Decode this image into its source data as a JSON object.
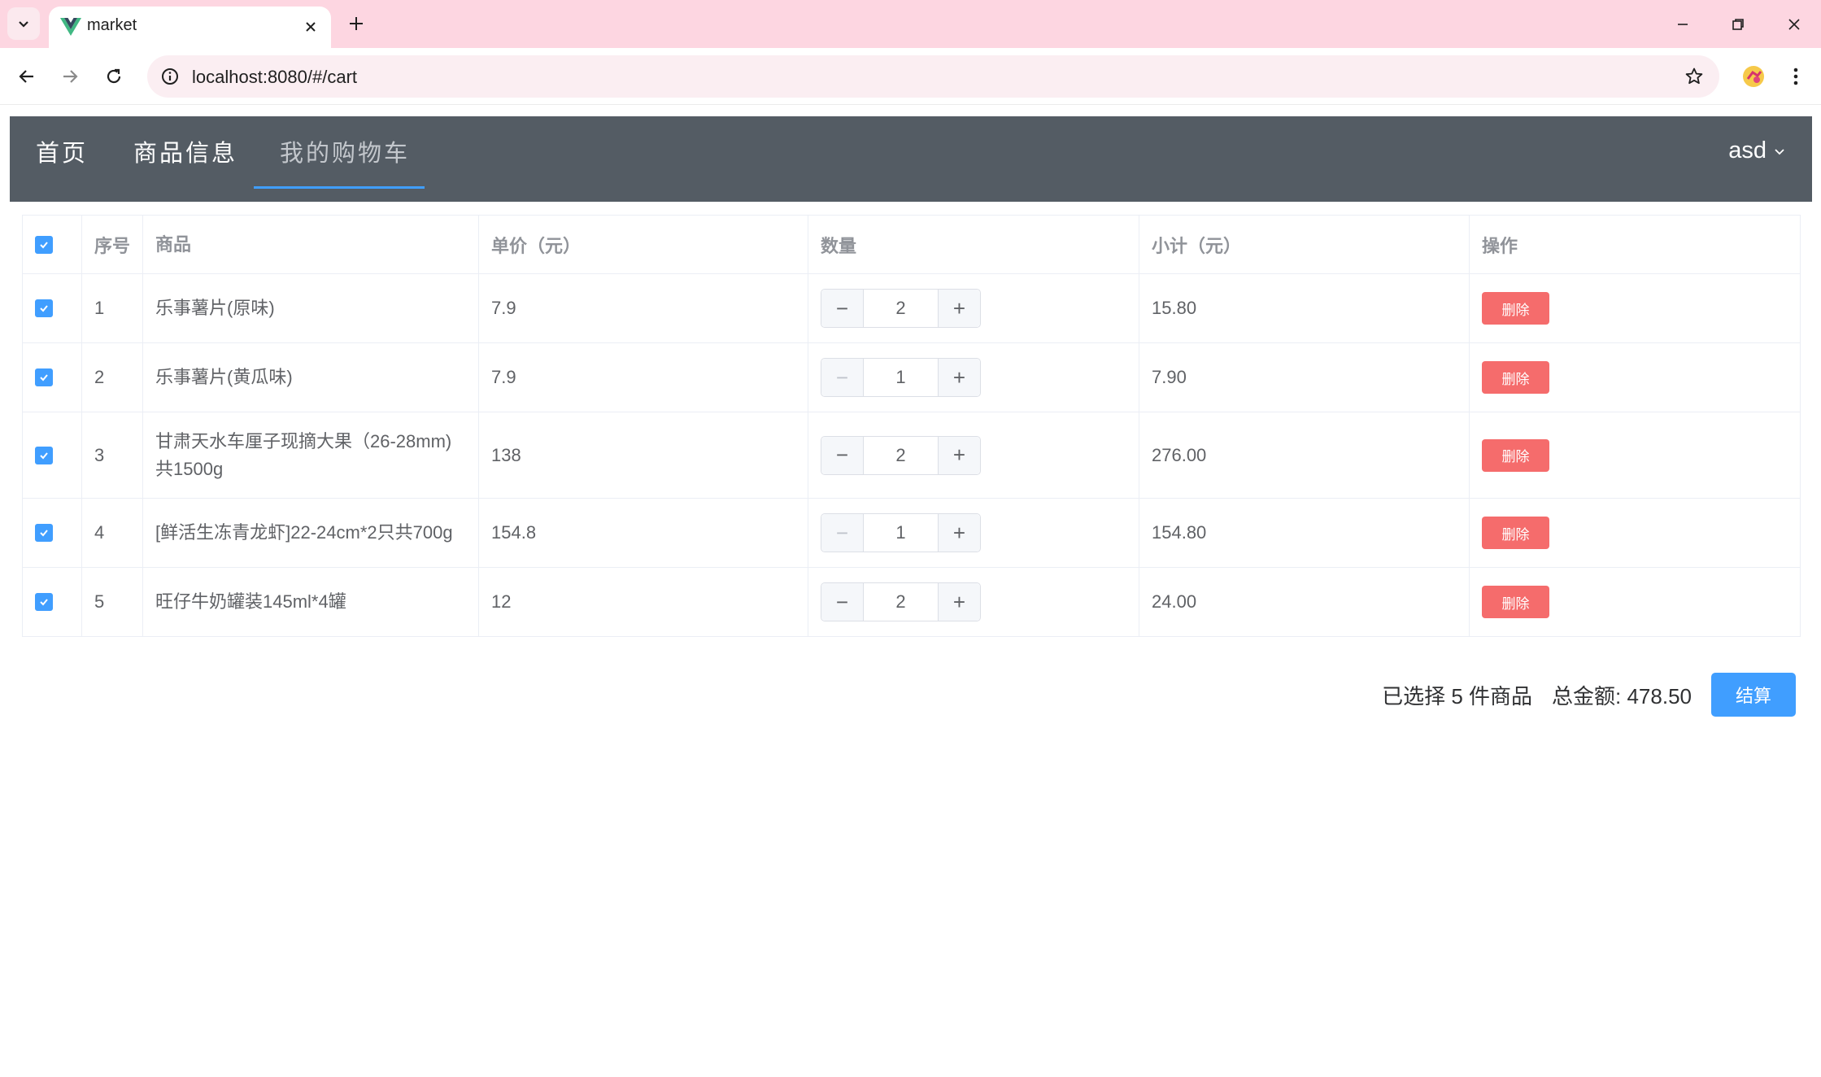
{
  "browser": {
    "tab_title": "market",
    "url": "localhost:8080/#/cart"
  },
  "nav": {
    "items": [
      {
        "label": "首页"
      },
      {
        "label": "商品信息"
      },
      {
        "label": "我的购物车"
      }
    ],
    "active": "我的购物车",
    "user": "asd"
  },
  "cart": {
    "headers": {
      "index": "序号",
      "product": "商品",
      "price": "单价（元）",
      "quantity": "数量",
      "subtotal": "小计（元）",
      "actions": "操作"
    },
    "rows": [
      {
        "index": "1",
        "name": "乐事薯片(原味)",
        "price": "7.9",
        "qty": "2",
        "subtotal": "15.80",
        "delete": "删除",
        "checked": true
      },
      {
        "index": "2",
        "name": "乐事薯片(黄瓜味)",
        "price": "7.9",
        "qty": "1",
        "subtotal": "7.90",
        "delete": "删除",
        "checked": true
      },
      {
        "index": "3",
        "name": "甘肃天水车厘子现摘大果（26-28mm)共1500g",
        "price": "138",
        "qty": "2",
        "subtotal": "276.00",
        "delete": "删除",
        "checked": true
      },
      {
        "index": "4",
        "name": "[鲜活生冻青龙虾]22-24cm*2只共700g",
        "price": "154.8",
        "qty": "1",
        "subtotal": "154.80",
        "delete": "删除",
        "checked": true
      },
      {
        "index": "5",
        "name": "旺仔牛奶罐装145ml*4罐",
        "price": "12",
        "qty": "2",
        "subtotal": "24.00",
        "delete": "删除",
        "checked": true
      }
    ]
  },
  "summary": {
    "selected_text": "已选择 5 件商品",
    "total_text": "总金额: 478.50",
    "checkout_label": "结算"
  },
  "colors": {
    "nav_bg": "#545c64",
    "accent": "#409eff",
    "danger": "#f56c6c",
    "tabstrip": "#fdd6e1"
  }
}
